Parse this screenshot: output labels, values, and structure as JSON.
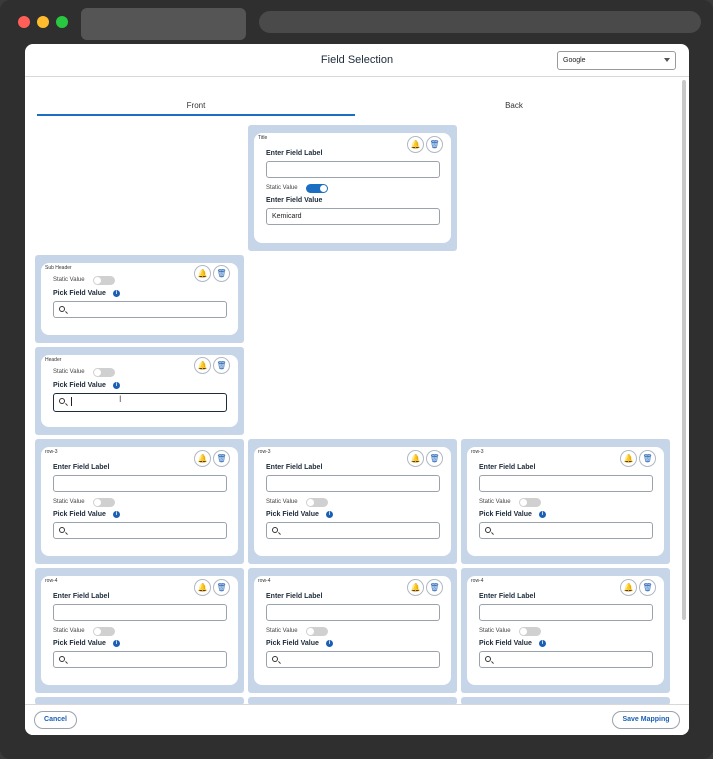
{
  "modal": {
    "title": "Field Selection",
    "selected_option": "Google"
  },
  "tabs": [
    {
      "label": "Front"
    },
    {
      "label": "Back"
    }
  ],
  "common": {
    "enter_label": "Enter Field Label",
    "static_value": "Static Value",
    "pick_value": "Pick Field Value",
    "enter_value": "Enter Field Value"
  },
  "cards": {
    "title": {
      "tag": "Title",
      "value": "Kemicard"
    },
    "subheader": {
      "tag": "Sub Header"
    },
    "header": {
      "tag": "Header"
    },
    "row3": {
      "tag": "row-3"
    },
    "row4": {
      "tag": "row-4"
    }
  },
  "footer": {
    "cancel": "Cancel",
    "save": "Save Mapping"
  },
  "colors": {
    "accent": "#1b6ec2",
    "card_bg": "#c6d6e8"
  }
}
